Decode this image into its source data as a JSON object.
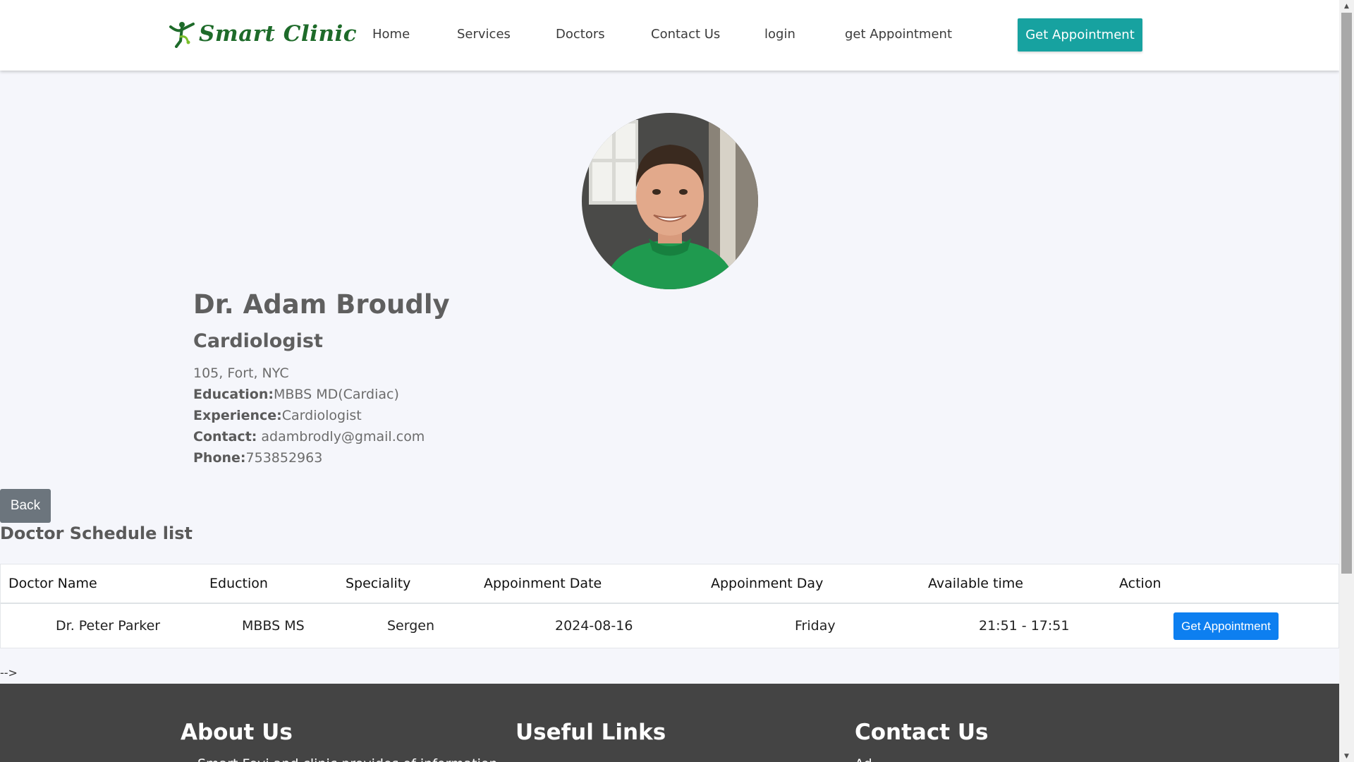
{
  "brand": {
    "name": "Smart Clinic",
    "color": "#1e6b2a"
  },
  "nav": {
    "items": [
      "Home",
      "Services",
      "Doctors",
      "Contact Us",
      "login",
      "get Appointment"
    ],
    "cta_label": "Get Appointment",
    "cta_color": "#17a2a0"
  },
  "doctor": {
    "name": "Dr. Adam Broudly",
    "specialty": "Cardiologist",
    "address": "105, Fort, NYC",
    "education_label": "Education:",
    "education": "MBBS MD(Cardiac)",
    "experience_label": "Experience:",
    "experience": "Cardiologist",
    "contact_label": "Contact:",
    "contact": " adambrodly@gmail.com",
    "phone_label": "Phone:",
    "phone": "753852963"
  },
  "back_label": "Back",
  "schedule": {
    "title": "Doctor Schedule list",
    "columns": [
      "Doctor Name",
      "Eduction",
      "Speciality",
      "Appoinment Date",
      "Appoinment Day",
      "Available time",
      "Action"
    ],
    "rows": [
      {
        "doctor_name": "Dr. Peter Parker",
        "education": "MBBS MS",
        "speciality": "Sergen",
        "date": "2024-08-16",
        "day": "Friday",
        "time": "21:51 - 17:51",
        "action_label": "Get Appointment"
      }
    ],
    "action_color": "#0d7ff0"
  },
  "stray_text": "-->",
  "footer": {
    "about_title": "About Us",
    "about_text": "Smart Fevi and clinic provides of information",
    "links_title": "Useful Links",
    "contact_title": "Contact Us",
    "contact_text": "Ad",
    "background": "#444444"
  },
  "icons": {
    "logo": "caduceus-figure-icon",
    "scroll_up": "triangle-up-icon",
    "scroll_down": "triangle-down-icon"
  }
}
